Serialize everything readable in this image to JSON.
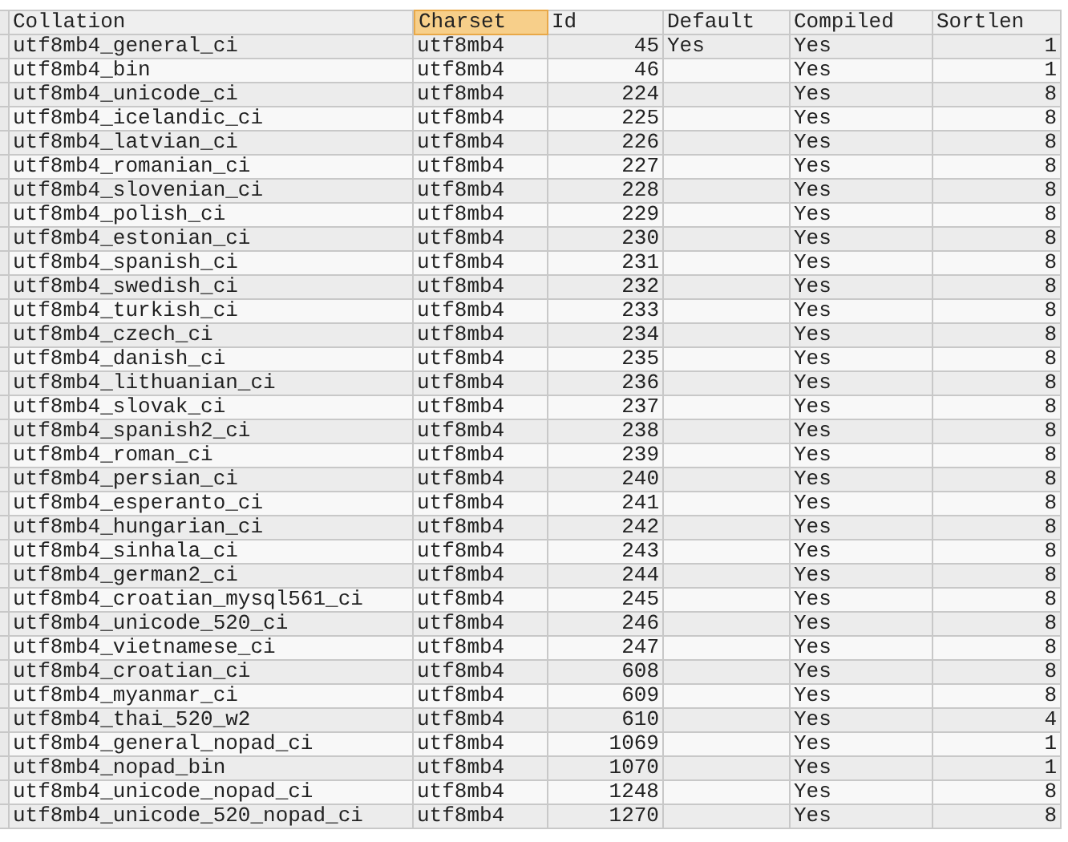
{
  "table": {
    "columns": [
      {
        "label": "Collation",
        "selected": false
      },
      {
        "label": "Charset",
        "selected": true
      },
      {
        "label": "Id",
        "selected": false
      },
      {
        "label": "Default",
        "selected": false
      },
      {
        "label": "Compiled",
        "selected": false
      },
      {
        "label": "Sortlen",
        "selected": false
      }
    ],
    "rows": [
      [
        "utf8mb4_general_ci",
        "utf8mb4",
        "45",
        "Yes",
        "Yes",
        "1"
      ],
      [
        "utf8mb4_bin",
        "utf8mb4",
        "46",
        null,
        "Yes",
        "1"
      ],
      [
        "utf8mb4_unicode_ci",
        "utf8mb4",
        "224",
        null,
        "Yes",
        "8"
      ],
      [
        "utf8mb4_icelandic_ci",
        "utf8mb4",
        "225",
        null,
        "Yes",
        "8"
      ],
      [
        "utf8mb4_latvian_ci",
        "utf8mb4",
        "226",
        null,
        "Yes",
        "8"
      ],
      [
        "utf8mb4_romanian_ci",
        "utf8mb4",
        "227",
        null,
        "Yes",
        "8"
      ],
      [
        "utf8mb4_slovenian_ci",
        "utf8mb4",
        "228",
        null,
        "Yes",
        "8"
      ],
      [
        "utf8mb4_polish_ci",
        "utf8mb4",
        "229",
        null,
        "Yes",
        "8"
      ],
      [
        "utf8mb4_estonian_ci",
        "utf8mb4",
        "230",
        null,
        "Yes",
        "8"
      ],
      [
        "utf8mb4_spanish_ci",
        "utf8mb4",
        "231",
        null,
        "Yes",
        "8"
      ],
      [
        "utf8mb4_swedish_ci",
        "utf8mb4",
        "232",
        null,
        "Yes",
        "8"
      ],
      [
        "utf8mb4_turkish_ci",
        "utf8mb4",
        "233",
        null,
        "Yes",
        "8"
      ],
      [
        "utf8mb4_czech_ci",
        "utf8mb4",
        "234",
        null,
        "Yes",
        "8"
      ],
      [
        "utf8mb4_danish_ci",
        "utf8mb4",
        "235",
        null,
        "Yes",
        "8"
      ],
      [
        "utf8mb4_lithuanian_ci",
        "utf8mb4",
        "236",
        null,
        "Yes",
        "8"
      ],
      [
        "utf8mb4_slovak_ci",
        "utf8mb4",
        "237",
        null,
        "Yes",
        "8"
      ],
      [
        "utf8mb4_spanish2_ci",
        "utf8mb4",
        "238",
        null,
        "Yes",
        "8"
      ],
      [
        "utf8mb4_roman_ci",
        "utf8mb4",
        "239",
        null,
        "Yes",
        "8"
      ],
      [
        "utf8mb4_persian_ci",
        "utf8mb4",
        "240",
        null,
        "Yes",
        "8"
      ],
      [
        "utf8mb4_esperanto_ci",
        "utf8mb4",
        "241",
        null,
        "Yes",
        "8"
      ],
      [
        "utf8mb4_hungarian_ci",
        "utf8mb4",
        "242",
        null,
        "Yes",
        "8"
      ],
      [
        "utf8mb4_sinhala_ci",
        "utf8mb4",
        "243",
        null,
        "Yes",
        "8"
      ],
      [
        "utf8mb4_german2_ci",
        "utf8mb4",
        "244",
        null,
        "Yes",
        "8"
      ],
      [
        "utf8mb4_croatian_mysql561_ci",
        "utf8mb4",
        "245",
        null,
        "Yes",
        "8"
      ],
      [
        "utf8mb4_unicode_520_ci",
        "utf8mb4",
        "246",
        null,
        "Yes",
        "8"
      ],
      [
        "utf8mb4_vietnamese_ci",
        "utf8mb4",
        "247",
        null,
        "Yes",
        "8"
      ],
      [
        "utf8mb4_croatian_ci",
        "utf8mb4",
        "608",
        null,
        "Yes",
        "8"
      ],
      [
        "utf8mb4_myanmar_ci",
        "utf8mb4",
        "609",
        null,
        "Yes",
        "8"
      ],
      [
        "utf8mb4_thai_520_w2",
        "utf8mb4",
        "610",
        null,
        "Yes",
        "4"
      ],
      [
        "utf8mb4_general_nopad_ci",
        "utf8mb4",
        "1069",
        null,
        "Yes",
        "1"
      ],
      [
        "utf8mb4_nopad_bin",
        "utf8mb4",
        "1070",
        null,
        "Yes",
        "1"
      ],
      [
        "utf8mb4_unicode_nopad_ci",
        "utf8mb4",
        "1248",
        null,
        "Yes",
        "8"
      ],
      [
        "utf8mb4_unicode_520_nopad_ci",
        "utf8mb4",
        "1270",
        null,
        "Yes",
        "8"
      ]
    ]
  }
}
